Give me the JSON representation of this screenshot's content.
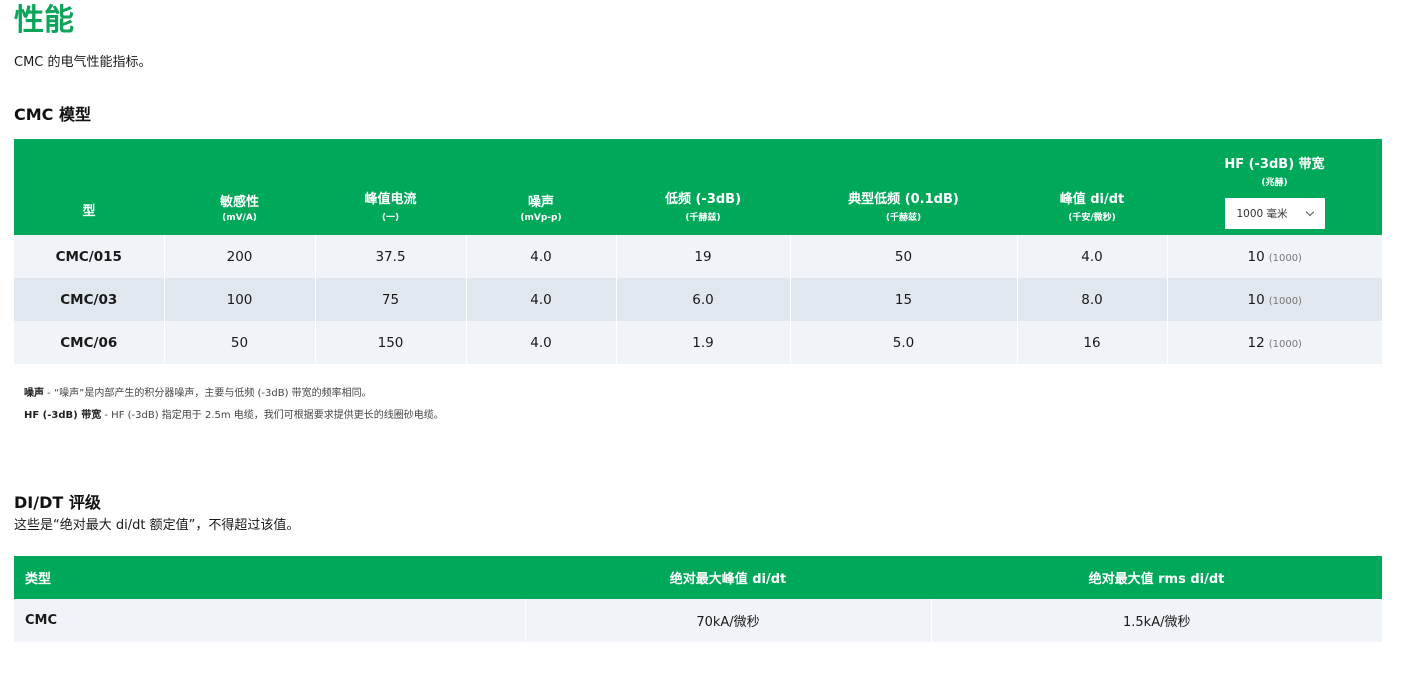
{
  "page": {
    "title": "性能",
    "intro": "CMC 的电气性能指标。"
  },
  "model_section": {
    "title": "CMC 模型",
    "columns": [
      {
        "label": "型",
        "unit": ""
      },
      {
        "label": "敏感性",
        "unit": "(mV/A)"
      },
      {
        "label": "峰值电流",
        "unit": "(一)"
      },
      {
        "label": "噪声",
        "unit": "(mVp-p)"
      },
      {
        "label": "低频 (-3dB)",
        "unit": "(千赫兹)"
      },
      {
        "label": "典型低频 (0.1dB)",
        "unit": "(千赫兹)"
      },
      {
        "label": "峰值 di/dt",
        "unit": "(千安/微秒)"
      },
      {
        "label": "HF (-3dB) 带宽",
        "unit": "(兆赫)"
      }
    ],
    "hf_select": {
      "value": "1000 毫米"
    },
    "rows": [
      {
        "type": "CMC/015",
        "sensitivity": "200",
        "peak_current": "37.5",
        "noise": "4.0",
        "lf": "19",
        "typ_lf": "50",
        "peak_didt": "4.0",
        "hf": "10",
        "hf_paren": "(1000)"
      },
      {
        "type": "CMC/03",
        "sensitivity": "100",
        "peak_current": "75",
        "noise": "4.0",
        "lf": "6.0",
        "typ_lf": "15",
        "peak_didt": "8.0",
        "hf": "10",
        "hf_paren": "(1000)"
      },
      {
        "type": "CMC/06",
        "sensitivity": "50",
        "peak_current": "150",
        "noise": "4.0",
        "lf": "1.9",
        "typ_lf": "5.0",
        "peak_didt": "16",
        "hf": "12",
        "hf_paren": "(1000)"
      }
    ],
    "notes": [
      {
        "term": "噪声",
        "text": " - “噪声”是内部产生的积分器噪声，主要与低频 (-3dB) 带宽的频率相同。"
      },
      {
        "term": "HF (-3dB) 带宽",
        "text": " - HF (-3dB) 指定用于 2.5m 电缆，我们可根据要求提供更长的线圈砂电缆。"
      }
    ]
  },
  "didt_section": {
    "title": "DI/DT 评级",
    "desc": "这些是“绝对最大 di/dt 额定值”，不得超过该值。",
    "columns": [
      "类型",
      "绝对最大峰值 di/dt",
      "绝对最大值 rms di/dt"
    ],
    "rows": [
      {
        "type": "CMC",
        "peak": "70kA/微秒",
        "rms": "1.5kA/微秒"
      }
    ]
  }
}
